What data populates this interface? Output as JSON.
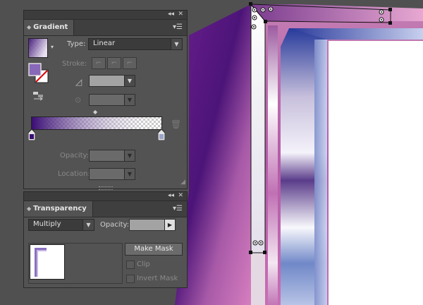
{
  "gradient_panel": {
    "title": "Gradient",
    "type_label": "Type:",
    "type_value": "Linear",
    "stroke_label": "Stroke:",
    "opacity_label": "Opacity:",
    "location_label": "Location:",
    "gradient_start_color": "#3a0d74",
    "gradient_end_color": "#ffffff"
  },
  "transparency_panel": {
    "title": "Transparency",
    "blend_mode": "Multiply",
    "opacity_label": "Opacity:",
    "make_mask_label": "Make Mask",
    "clip_label": "Clip",
    "invert_mask_label": "Invert Mask"
  },
  "icons": {
    "collapse": "double-chevron-icon",
    "close": "close-icon",
    "panel_menu": "panel-menu-icon",
    "angle": "angle-icon",
    "aspect_ratio": "aspect-ratio-icon",
    "delete_stop": "trash-icon",
    "reverse_gradient": "reverse-gradient-icon"
  },
  "colors": {
    "panel_bg": "#535353",
    "titlebar_bg": "#3c3c3c",
    "canvas_bg": "#505050",
    "artwork_purple": "#7a2a9a",
    "artwork_pink": "#c070b8",
    "artwork_blue": "#5a6ec8"
  }
}
